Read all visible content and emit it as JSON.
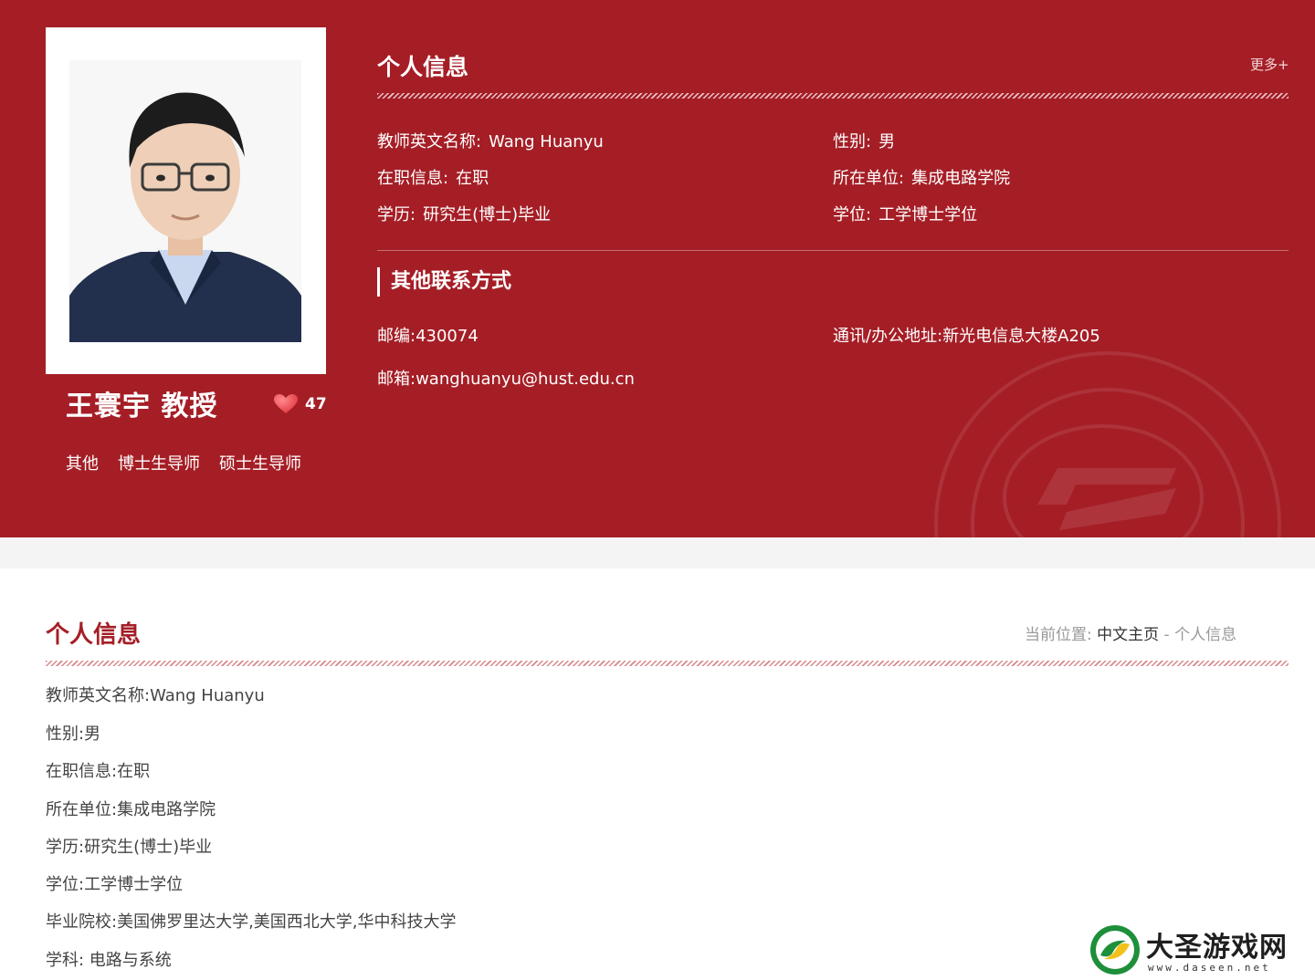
{
  "profile": {
    "name": "王寰宇 教授",
    "likes": "47",
    "roles": [
      "其他",
      "博士生导师",
      "硕士生导师"
    ]
  },
  "info_card": {
    "title": "个人信息",
    "more": "更多+",
    "fields": [
      {
        "label": "教师英文名称:",
        "value": "Wang Huanyu"
      },
      {
        "label": "性别:",
        "value": "男"
      },
      {
        "label": "在职信息:",
        "value": "在职"
      },
      {
        "label": "所在单位:",
        "value": "集成电路学院"
      },
      {
        "label": "学历:",
        "value": "研究生(博士)毕业"
      },
      {
        "label": "学位:",
        "value": "工学博士学位"
      }
    ]
  },
  "contact": {
    "title": "其他联系方式",
    "fields": [
      {
        "label": "邮编:",
        "value": "430074"
      },
      {
        "label": "通讯/办公地址:",
        "value": "新光电信息大楼A205"
      },
      {
        "label": "邮箱:",
        "value": "wanghuanyu@hust.edu.cn"
      }
    ]
  },
  "main": {
    "title": "个人信息",
    "breadcrumb": {
      "prefix": "当前位置:",
      "home": "中文主页",
      "separator": "-",
      "current": "个人信息"
    },
    "details": [
      "教师英文名称:Wang Huanyu",
      "性别:男",
      "在职信息:在职",
      "所在单位:集成电路学院",
      "学历:研究生(博士)毕业",
      "学位:工学博士学位",
      "毕业院校:美国佛罗里达大学,美国西北大学,华中科技大学",
      "学科: 电路与系统"
    ]
  },
  "watermark": {
    "title": "大圣游戏网",
    "url": "www.daseen.net"
  },
  "colors": {
    "brand_red": "#a51e26",
    "heart": "#e0323a",
    "spacer_gray": "#f4f4f4"
  },
  "icons": {
    "likes": "heart-icon",
    "seal": "university-seal-watermark",
    "watermark_logo": "daseen-logo-icon"
  }
}
